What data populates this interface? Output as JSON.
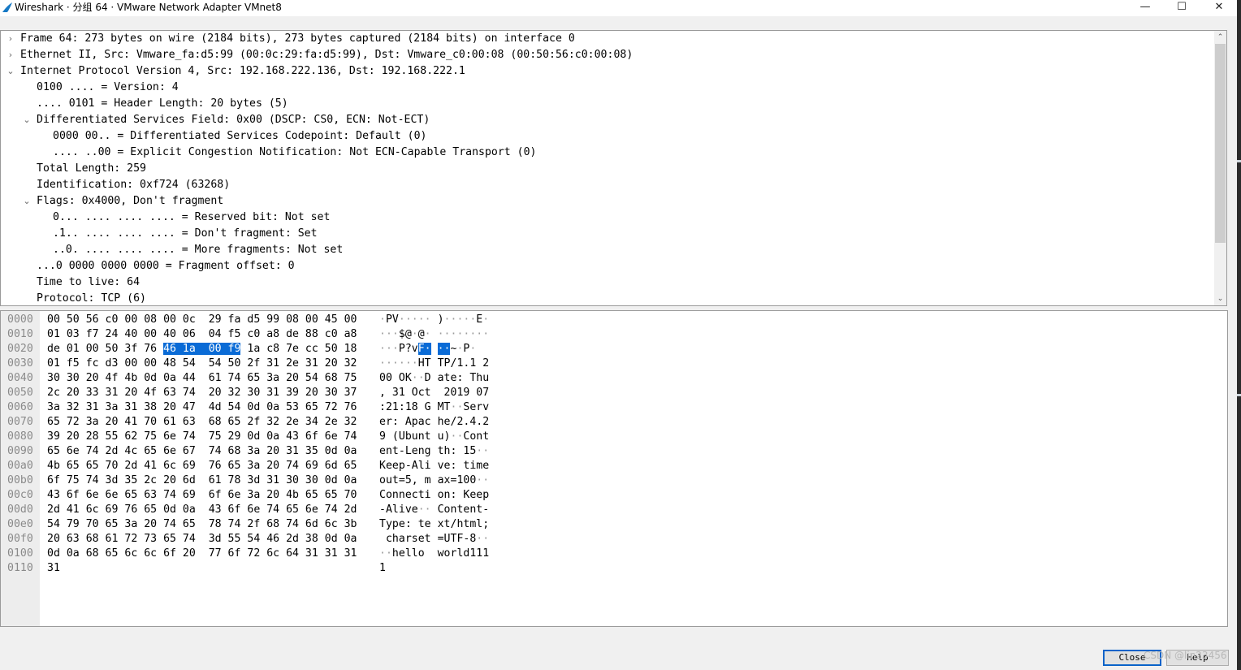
{
  "window": {
    "title": "Wireshark · 分组 64 · VMware Network Adapter VMnet8",
    "minimize_glyph": "—",
    "maximize_glyph": "☐",
    "close_glyph": "✕",
    "app_icon": "wireshark-fin-icon"
  },
  "details": {
    "lines": [
      {
        "text": "Frame 64: 273 bytes on wire (2184 bits), 273 bytes captured (2184 bits) on interface 0",
        "expander": "collapsed",
        "indent": 0
      },
      {
        "text": "Ethernet II, Src: Vmware_fa:d5:99 (00:0c:29:fa:d5:99), Dst: Vmware_c0:00:08 (00:50:56:c0:00:08)",
        "expander": "collapsed",
        "indent": 0
      },
      {
        "text": "Internet Protocol Version 4, Src: 192.168.222.136, Dst: 192.168.222.1",
        "expander": "expanded",
        "indent": 0
      },
      {
        "text": "0100 .... = Version: 4",
        "expander": "none",
        "indent": 1
      },
      {
        "text": ".... 0101 = Header Length: 20 bytes (5)",
        "expander": "none",
        "indent": 1
      },
      {
        "text": "Differentiated Services Field: 0x00 (DSCP: CS0, ECN: Not-ECT)",
        "expander": "expanded",
        "indent": 1
      },
      {
        "text": "0000 00.. = Differentiated Services Codepoint: Default (0)",
        "expander": "none",
        "indent": 2
      },
      {
        "text": ".... ..00 = Explicit Congestion Notification: Not ECN-Capable Transport (0)",
        "expander": "none",
        "indent": 2
      },
      {
        "text": "Total Length: 259",
        "expander": "none",
        "indent": 1
      },
      {
        "text": "Identification: 0xf724 (63268)",
        "expander": "none",
        "indent": 1
      },
      {
        "text": "Flags: 0x4000, Don't fragment",
        "expander": "expanded",
        "indent": 1
      },
      {
        "text": "0... .... .... .... = Reserved bit: Not set",
        "expander": "none",
        "indent": 2
      },
      {
        "text": ".1.. .... .... .... = Don't fragment: Set",
        "expander": "none",
        "indent": 2
      },
      {
        "text": "..0. .... .... .... = More fragments: Not set",
        "expander": "none",
        "indent": 2
      },
      {
        "text": "...0 0000 0000 0000 = Fragment offset: 0",
        "expander": "none",
        "indent": 1
      },
      {
        "text": "Time to live: 64",
        "expander": "none",
        "indent": 1
      },
      {
        "text": "Protocol: TCP (6)",
        "expander": "none",
        "indent": 1
      }
    ],
    "scroll_up_glyph": "⌃",
    "scroll_down_glyph": "⌄"
  },
  "bytes": {
    "selected": {
      "row": 2,
      "hex_cols": [
        6,
        7,
        8,
        9
      ],
      "ascii_cols": [
        6,
        7,
        8,
        9
      ]
    },
    "rows": [
      {
        "offset": "0000",
        "hex": [
          "00",
          "50",
          "56",
          "c0",
          "00",
          "08",
          "00",
          "0c",
          "29",
          "fa",
          "d5",
          "99",
          "08",
          "00",
          "45",
          "00"
        ],
        "ascii": "·PV·····)·····E·"
      },
      {
        "offset": "0010",
        "hex": [
          "01",
          "03",
          "f7",
          "24",
          "40",
          "00",
          "40",
          "06",
          "04",
          "f5",
          "c0",
          "a8",
          "de",
          "88",
          "c0",
          "a8"
        ],
        "ascii": "···$@·@·········"
      },
      {
        "offset": "0020",
        "hex": [
          "de",
          "01",
          "00",
          "50",
          "3f",
          "76",
          "46",
          "1a",
          "00",
          "f9",
          "1a",
          "c8",
          "7e",
          "cc",
          "50",
          "18"
        ],
        "ascii": "···P?vF···~·P·"
      },
      {
        "offset": "0030",
        "hex": [
          "01",
          "f5",
          "fc",
          "d3",
          "00",
          "00",
          "48",
          "54",
          "54",
          "50",
          "2f",
          "31",
          "2e",
          "31",
          "20",
          "32"
        ],
        "ascii": "······HTTP/1.1 2"
      },
      {
        "offset": "0040",
        "hex": [
          "30",
          "30",
          "20",
          "4f",
          "4b",
          "0d",
          "0a",
          "44",
          "61",
          "74",
          "65",
          "3a",
          "20",
          "54",
          "68",
          "75"
        ],
        "ascii": "00 OK··Date: Thu"
      },
      {
        "offset": "0050",
        "hex": [
          "2c",
          "20",
          "33",
          "31",
          "20",
          "4f",
          "63",
          "74",
          "20",
          "32",
          "30",
          "31",
          "39",
          "20",
          "30",
          "37"
        ],
        "ascii": ", 31 Oct 2019 07"
      },
      {
        "offset": "0060",
        "hex": [
          "3a",
          "32",
          "31",
          "3a",
          "31",
          "38",
          "20",
          "47",
          "4d",
          "54",
          "0d",
          "0a",
          "53",
          "65",
          "72",
          "76"
        ],
        "ascii": ":21:18 GMT··Serv"
      },
      {
        "offset": "0070",
        "hex": [
          "65",
          "72",
          "3a",
          "20",
          "41",
          "70",
          "61",
          "63",
          "68",
          "65",
          "2f",
          "32",
          "2e",
          "34",
          "2e",
          "32"
        ],
        "ascii": "er: Apache/2.4.2"
      },
      {
        "offset": "0080",
        "hex": [
          "39",
          "20",
          "28",
          "55",
          "62",
          "75",
          "6e",
          "74",
          "75",
          "29",
          "0d",
          "0a",
          "43",
          "6f",
          "6e",
          "74"
        ],
        "ascii": "9 (Ubuntu)··Cont"
      },
      {
        "offset": "0090",
        "hex": [
          "65",
          "6e",
          "74",
          "2d",
          "4c",
          "65",
          "6e",
          "67",
          "74",
          "68",
          "3a",
          "20",
          "31",
          "35",
          "0d",
          "0a"
        ],
        "ascii": "ent-Length: 15··"
      },
      {
        "offset": "00a0",
        "hex": [
          "4b",
          "65",
          "65",
          "70",
          "2d",
          "41",
          "6c",
          "69",
          "76",
          "65",
          "3a",
          "20",
          "74",
          "69",
          "6d",
          "65"
        ],
        "ascii": "Keep-Alive: time"
      },
      {
        "offset": "00b0",
        "hex": [
          "6f",
          "75",
          "74",
          "3d",
          "35",
          "2c",
          "20",
          "6d",
          "61",
          "78",
          "3d",
          "31",
          "30",
          "30",
          "0d",
          "0a"
        ],
        "ascii": "out=5, max=100··"
      },
      {
        "offset": "00c0",
        "hex": [
          "43",
          "6f",
          "6e",
          "6e",
          "65",
          "63",
          "74",
          "69",
          "6f",
          "6e",
          "3a",
          "20",
          "4b",
          "65",
          "65",
          "70"
        ],
        "ascii": "Connection: Keep"
      },
      {
        "offset": "00d0",
        "hex": [
          "2d",
          "41",
          "6c",
          "69",
          "76",
          "65",
          "0d",
          "0a",
          "43",
          "6f",
          "6e",
          "74",
          "65",
          "6e",
          "74",
          "2d"
        ],
        "ascii": "-Alive··Content-"
      },
      {
        "offset": "00e0",
        "hex": [
          "54",
          "79",
          "70",
          "65",
          "3a",
          "20",
          "74",
          "65",
          "78",
          "74",
          "2f",
          "68",
          "74",
          "6d",
          "6c",
          "3b"
        ],
        "ascii": "Type: text/html;"
      },
      {
        "offset": "00f0",
        "hex": [
          "20",
          "63",
          "68",
          "61",
          "72",
          "73",
          "65",
          "74",
          "3d",
          "55",
          "54",
          "46",
          "2d",
          "38",
          "0d",
          "0a"
        ],
        "ascii": " charset=UTF-8··"
      },
      {
        "offset": "0100",
        "hex": [
          "0d",
          "0a",
          "68",
          "65",
          "6c",
          "6c",
          "6f",
          "20",
          "77",
          "6f",
          "72",
          "6c",
          "64",
          "31",
          "31",
          "31"
        ],
        "ascii": "··hello world111"
      },
      {
        "offset": "0110",
        "hex": [
          "31"
        ],
        "ascii": "1"
      }
    ]
  },
  "buttons": {
    "close_label": "Close",
    "help_label": "Help"
  },
  "watermark": "CSDN @lin23456"
}
